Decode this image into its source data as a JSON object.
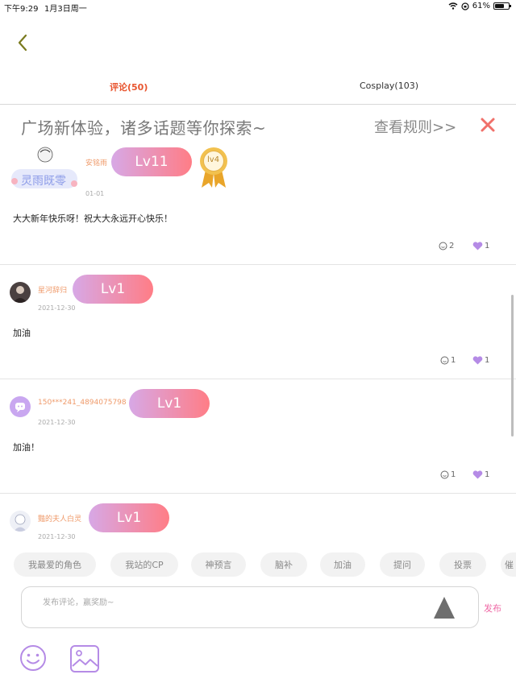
{
  "status_bar": {
    "time": "下午9:29",
    "date": "1月3日周一",
    "battery": "61%"
  },
  "tabs": [
    {
      "label": "评论(50)",
      "active": true
    },
    {
      "label": "Cosplay(103)",
      "active": false
    }
  ],
  "banner": {
    "text": "广场新体验，诸多话题等你探索~",
    "rules_link": "查看规则>>"
  },
  "comments": [
    {
      "avatar_frame_text": "灵雨既零",
      "username": "安铭雨",
      "level": "Lv11",
      "medal_level": "lv4",
      "date": "01-01",
      "text": "大大新年快乐呀！祝大大永远开心快乐！",
      "reply_count": "2",
      "like_count": "1"
    },
    {
      "username": "星河辞归",
      "level": "Lv1",
      "date": "2021-12-30",
      "text": "加油",
      "reply_count": "1",
      "like_count": "1"
    },
    {
      "username": "150***241_4894075798",
      "level": "Lv1",
      "date": "2021-12-30",
      "text": "加油！",
      "reply_count": "1",
      "like_count": "1"
    },
    {
      "username": "豔的夫人白灵",
      "level": "Lv1",
      "date": "2021-12-30"
    }
  ],
  "topic_chips": [
    "我最爱的角色",
    "我站的CP",
    "神预言",
    "脑补",
    "加油",
    "提问",
    "投票",
    "催"
  ],
  "input": {
    "placeholder": "发布评论，赢奖励~",
    "publish_label": "发布"
  },
  "colors": {
    "accent_orange": "#e8552f",
    "level_gradient_start": "#d7a8e6",
    "level_gradient_end": "#ff7d86",
    "like_purple": "#b58be6",
    "publish_pink": "#ef6aa6"
  }
}
